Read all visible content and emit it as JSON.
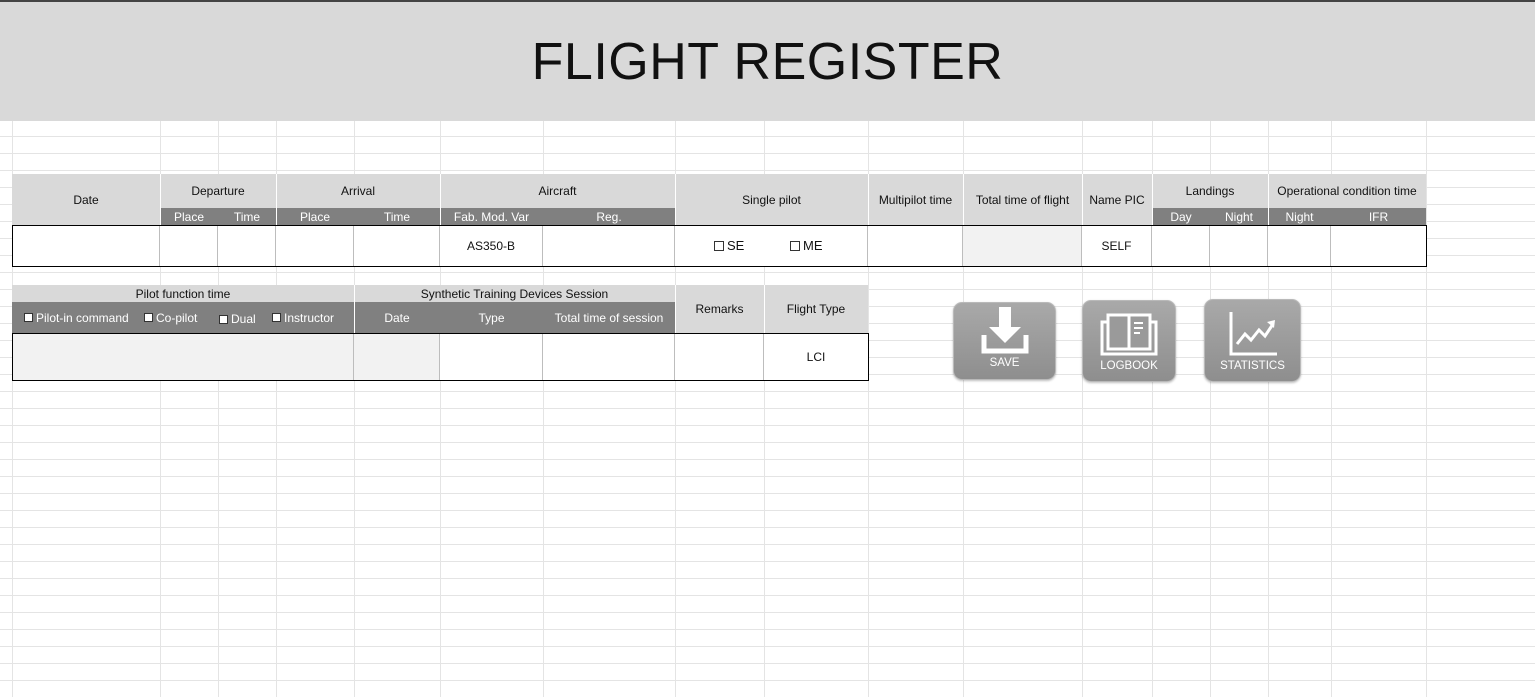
{
  "title": "FLIGHT REGISTER",
  "header": {
    "date": "Date",
    "departure": "Departure",
    "arrival": "Arrival",
    "aircraft": "Aircraft",
    "single_pilot": "Single pilot",
    "multipilot_time": "Multipilot time",
    "total_time_of_flight": "Total time of flight",
    "name_pic": "Name PIC",
    "landings": "Landings",
    "operational_condition_time": "Operational condition time",
    "place": "Place",
    "time": "Time",
    "fab_mod_var": "Fab. Mod. Var",
    "reg": "Reg.",
    "day": "Day",
    "night": "Night",
    "ifr": "IFR"
  },
  "row1": {
    "aircraft_type": "AS350-B",
    "se_label": "SE",
    "me_label": "ME",
    "name_pic": "SELF"
  },
  "section2": {
    "pilot_function_time": "Pilot function time",
    "pilot_in_command": "Pilot-in command",
    "co_pilot": "Co-pilot",
    "dual": "Dual",
    "instructor": "Instructor",
    "synthetic_training": "Synthetic Training Devices Session",
    "std_date": "Date",
    "std_type": "Type",
    "std_total": "Total time of session",
    "remarks": "Remarks",
    "flight_type": "Flight Type",
    "flight_type_value": "LCI"
  },
  "buttons": {
    "save": "SAVE",
    "logbook": "LOGBOOK",
    "statistics": "STATISTICS"
  }
}
